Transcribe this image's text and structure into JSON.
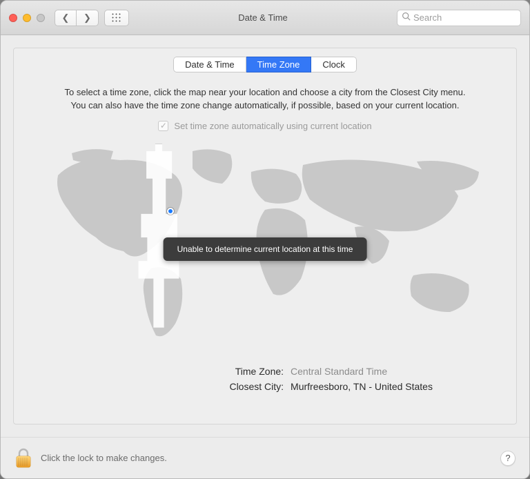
{
  "window": {
    "title": "Date & Time"
  },
  "search": {
    "placeholder": "Search"
  },
  "tabs": {
    "items": [
      "Date & Time",
      "Time Zone",
      "Clock"
    ],
    "active_index": 1
  },
  "main": {
    "instructions_line1": "To select a time zone, click the map near your location and choose a city from the Closest City menu.",
    "instructions_line2": "You can also have the time zone change automatically, if possible, based on your current location.",
    "auto_checkbox_label": "Set time zone automatically using current location",
    "auto_checkbox_checked": true,
    "auto_checkbox_enabled": false,
    "toast": "Unable to determine current location at this time",
    "timezone_label": "Time Zone:",
    "timezone_value": "Central Standard Time",
    "city_label": "Closest City:",
    "city_value": "Murfreesboro, TN - United States"
  },
  "footer": {
    "lock_text": "Click the lock to make changes.",
    "help_label": "?"
  }
}
